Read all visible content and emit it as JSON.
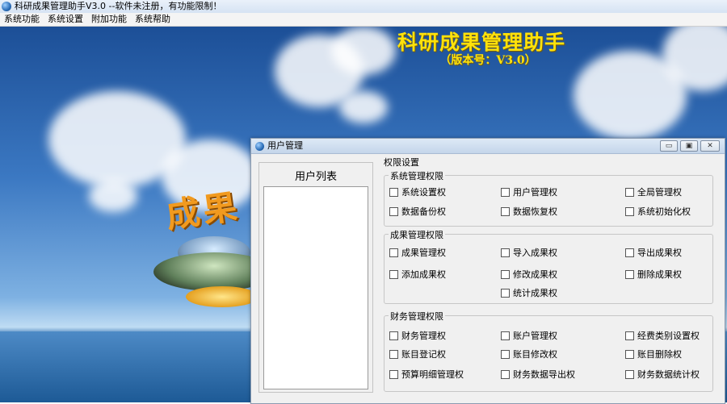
{
  "window": {
    "title": "科研成果管理助手V3.0 --软件未注册，有功能限制！"
  },
  "menu": [
    "系统功能",
    "系统设置",
    "附加功能",
    "系统帮助"
  ],
  "banner": {
    "title": "科研成果管理助手",
    "version": "（版本号：V3.0）",
    "logo_text": "成果"
  },
  "dialog": {
    "title": "用户管理",
    "controls": {
      "minimize": "▭",
      "restore": "▣",
      "close": "✕"
    },
    "user_list_title": "用户列表",
    "permissions_label": "权限设置",
    "groups": [
      {
        "title": "系统管理权限",
        "items": [
          "系统设置权",
          "用户管理权",
          "全局管理权",
          "数据备份权",
          "数据恢复权",
          "系统初始化权"
        ]
      },
      {
        "title": "成果管理权限",
        "items": [
          "成果管理权",
          "导入成果权",
          "导出成果权",
          "添加成果权",
          "修改成果权",
          "删除成果权",
          "统计成果权"
        ]
      },
      {
        "title": "财务管理权限",
        "items": [
          "财务管理权",
          "账户管理权",
          "经费类别设置权",
          "账目登记权",
          "账目修改权",
          "账目删除权",
          "预算明细管理权",
          "财务数据导出权",
          "财务数据统计权"
        ]
      }
    ]
  }
}
